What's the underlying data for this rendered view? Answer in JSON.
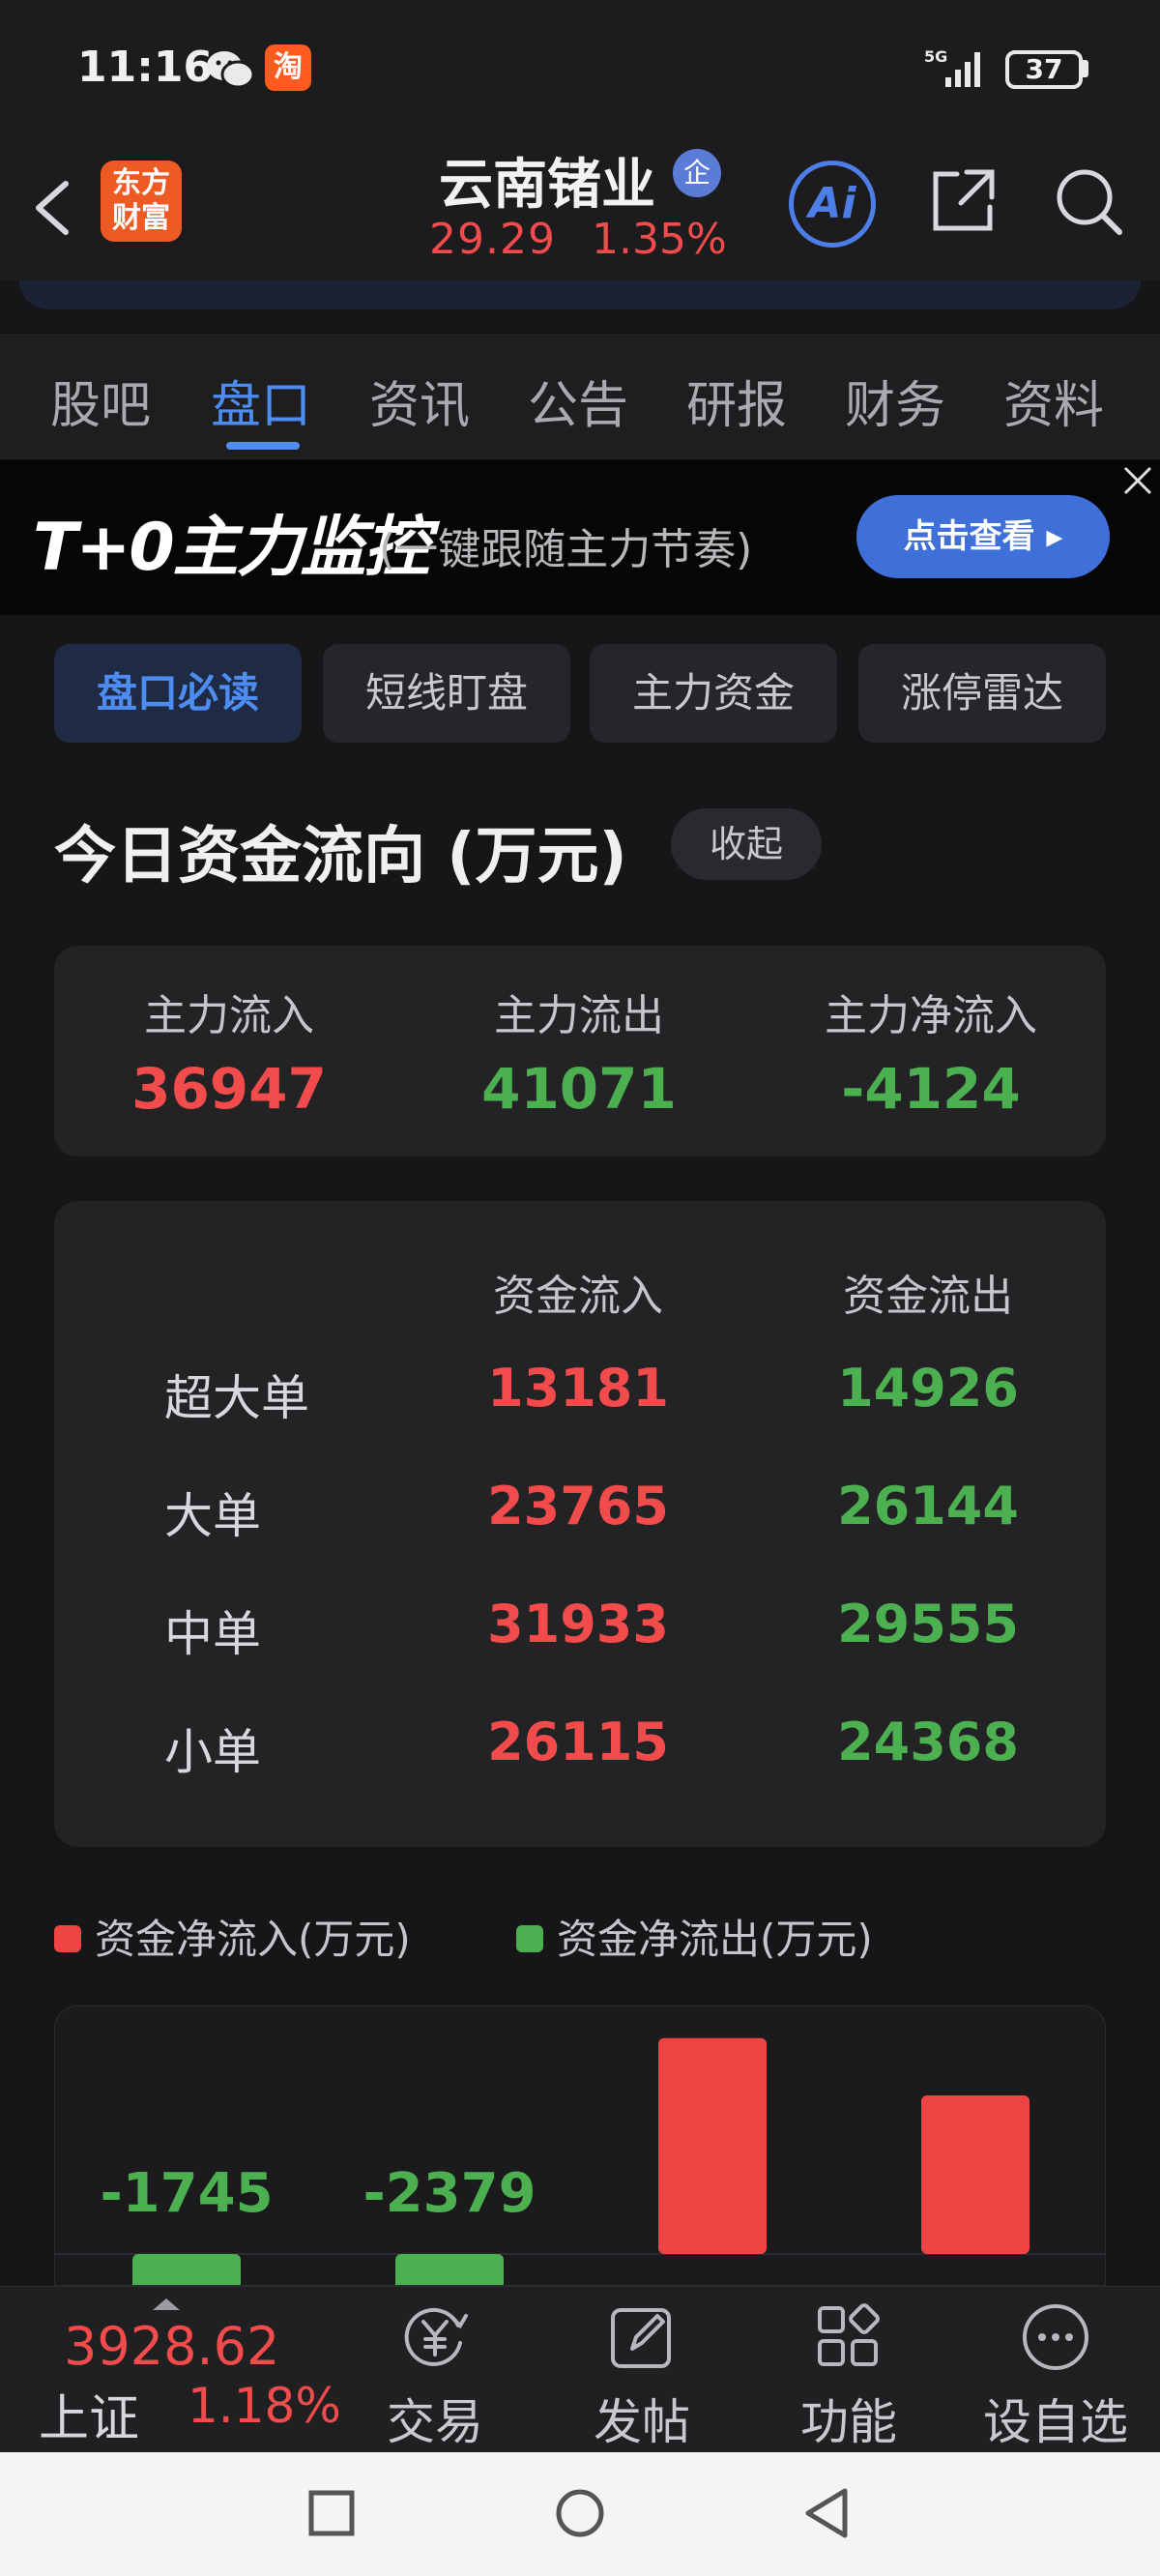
{
  "status_bar": {
    "time": "11:16",
    "network": "5G",
    "battery": "37",
    "taobao_glyph": "淘"
  },
  "header": {
    "app_logo_line1": "东方",
    "app_logo_line2": "财富",
    "stock_name": "云南锗业",
    "badge": "企",
    "price": "29.29",
    "change_pct": "1.35%",
    "ai_label": "Ai"
  },
  "tabs": [
    {
      "label": "股吧"
    },
    {
      "label": "盘口"
    },
    {
      "label": "资讯"
    },
    {
      "label": "公告"
    },
    {
      "label": "研报"
    },
    {
      "label": "财务"
    },
    {
      "label": "资料"
    }
  ],
  "banner": {
    "title": "T+0主力监控",
    "subtitle": "(一键跟随主力节奏)",
    "button": "点击查看 ▸"
  },
  "subtabs": [
    {
      "label": "盘口必读"
    },
    {
      "label": "短线盯盘"
    },
    {
      "label": "主力资金"
    },
    {
      "label": "涨停雷达"
    }
  ],
  "section": {
    "title": "今日资金流向 (万元)",
    "collapse": "收起"
  },
  "summary": [
    {
      "label": "主力流入",
      "value": "36947",
      "color": "#f14b4b"
    },
    {
      "label": "主力流出",
      "value": "41071",
      "color": "#4caf50"
    },
    {
      "label": "主力净流入",
      "value": "-4124",
      "color": "#4caf50"
    }
  ],
  "flow_table": {
    "headers": [
      "资金流入",
      "资金流出"
    ],
    "rows": [
      {
        "label": "超大单",
        "inflow": "13181",
        "outflow": "14926"
      },
      {
        "label": "大单",
        "inflow": "23765",
        "outflow": "26144"
      },
      {
        "label": "中单",
        "inflow": "31933",
        "outflow": "29555"
      },
      {
        "label": "小单",
        "inflow": "26115",
        "outflow": "24368"
      }
    ]
  },
  "legend": [
    {
      "label": "资金净流入(万元)",
      "color": "#ef4444"
    },
    {
      "label": "资金净流出(万元)",
      "color": "#4caf50"
    }
  ],
  "chart_data": {
    "type": "bar",
    "categories": [
      "超大单",
      "大单",
      "中单",
      "小单"
    ],
    "values": [
      -1745,
      -2379,
      2378,
      1747
    ],
    "labels": [
      "-1745",
      "-2379",
      "",
      ""
    ],
    "colors": {
      "positive": "#ef4444",
      "negative": "#4caf50"
    }
  },
  "bottom_bar": {
    "index_value": "3928.62",
    "index_name": "上证",
    "index_change": "1.18%",
    "items": [
      {
        "label": "交易",
        "icon": "yen-exchange-icon"
      },
      {
        "label": "发帖",
        "icon": "edit-icon"
      },
      {
        "label": "功能",
        "icon": "grid-icon"
      },
      {
        "label": "设自选",
        "icon": "more-icon"
      }
    ]
  }
}
